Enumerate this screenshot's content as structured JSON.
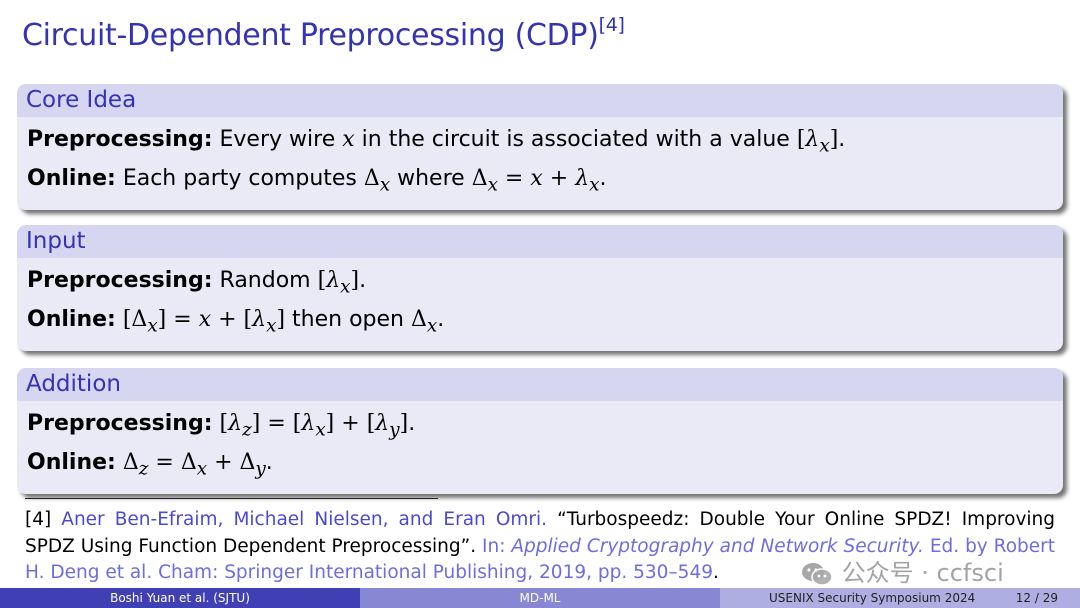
{
  "slide": {
    "title": "Circuit-Dependent Preprocessing (CDP)",
    "title_citation": "[4]"
  },
  "blocks": [
    {
      "heading": "Core Idea",
      "lines": [
        {
          "label": "Preprocessing:",
          "text": "Every wire x in the circuit is associated with a value [λx]."
        },
        {
          "label": "Online:",
          "text": "Each party computes Δx where Δx = x + λx."
        }
      ]
    },
    {
      "heading": "Input",
      "lines": [
        {
          "label": "Preprocessing:",
          "text": "Random [λx]."
        },
        {
          "label": "Online:",
          "text": "[Δx] = x + [λx] then open Δx."
        }
      ]
    },
    {
      "heading": "Addition",
      "lines": [
        {
          "label": "Preprocessing:",
          "text": "[λz] = [λx] + [λy]."
        },
        {
          "label": "Online:",
          "text": "Δz = Δx + Δy."
        }
      ]
    }
  ],
  "footnote": {
    "marker": "[4]",
    "authors": "Aner Ben-Efraim, Michael Nielsen, and Eran Omri.",
    "title": "“Turbospeedz: Double Your Online SPDZ! Improving SPDZ Using Function Dependent Preprocessing”.",
    "in_label": "In:",
    "venue": "Applied Cryptography and Network Security.",
    "editors": "Ed. by Robert H. Deng et al. Cham: Springer International Publishing, 2019, pp. 530–549",
    "end": "."
  },
  "watermark": {
    "icon": "wechat-icon",
    "text": "公众号 · ccfsci"
  },
  "footer": {
    "author": "Boshi Yuan et al. (SJTU)",
    "short_title": "MD-ML",
    "conference": "USENIX Security Symposium 2024",
    "page": "12 / 29"
  }
}
